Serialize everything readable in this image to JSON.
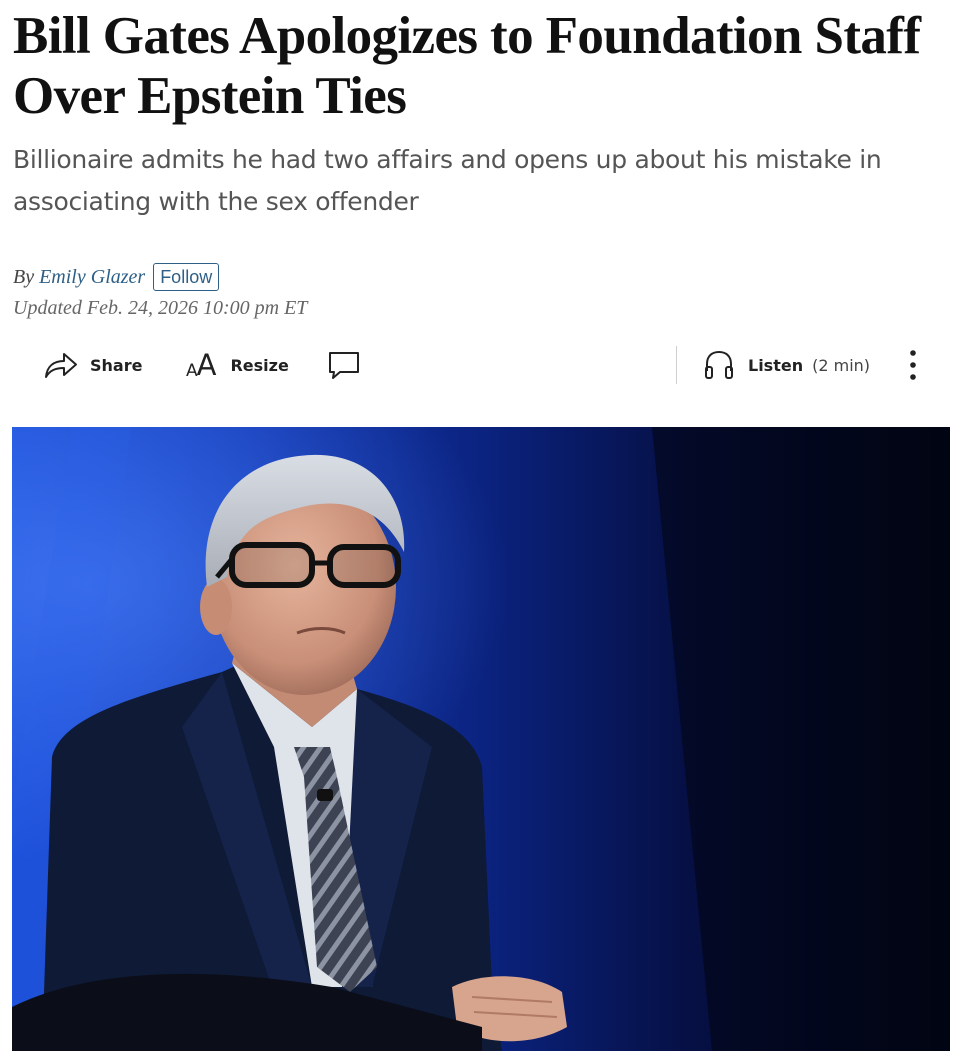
{
  "article": {
    "headline": "Bill Gates Apologizes to Foundation Staff Over Epstein Ties",
    "dek": "Billionaire admits he had two affairs and opens up about his mistake in associating with the sex offender",
    "byline": {
      "prefix": "By",
      "author": "Emily Glazer",
      "follow_label": "Follow"
    },
    "timestamp": "Updated Feb. 24, 2026 10:00 pm ET"
  },
  "toolbar": {
    "share_label": "Share",
    "resize_glyph_small": "A",
    "resize_glyph_big": "A",
    "resize_label": "Resize",
    "listen_label": "Listen",
    "listen_duration": "(2 min)",
    "icons": [
      "share-icon",
      "resize-icon",
      "comment-icon",
      "headphones-icon",
      "more-icon"
    ]
  },
  "colors": {
    "headline": "#111111",
    "dek": "#555555",
    "author_link": "#2e5f86",
    "hero_background": "#0a1f6b"
  }
}
